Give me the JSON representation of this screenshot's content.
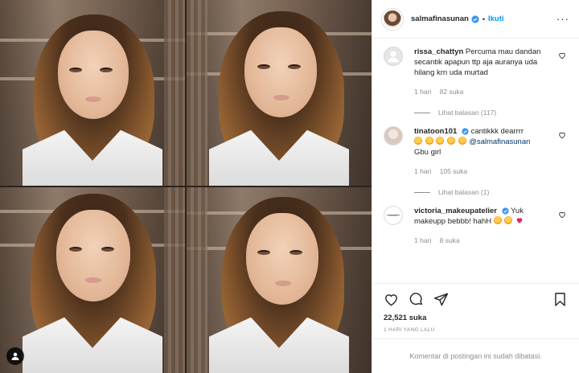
{
  "post": {
    "username": "salmafinasunan",
    "separator": "•",
    "follow_label": "Ikuti",
    "more_label": "···"
  },
  "comments": [
    {
      "username": "rissa_chattyn",
      "text": "Percuma mau dandan secantik apapun ttp aja auranya uda hilang krn uda murtad",
      "time": "1 hari",
      "likes": "82 suka",
      "replies_label": "Lihat balasan (117)"
    },
    {
      "username": "tinatoon101",
      "text": "cantikkk dearrrr",
      "mention": "@salmafinasunan",
      "text_after": "Gbu girl",
      "time": "1 hari",
      "likes": "105 suka",
      "replies_label": "Lihat balasan (1)"
    },
    {
      "username": "victoria_makeupatelier",
      "text": "Yuk makeupp bebbb! hahH",
      "time": "1 hari",
      "likes": "8 suka"
    }
  ],
  "likes_count": "22,521 suka",
  "post_date": "1 HARI YANG LALU",
  "comments_closed": "Komentar di postingan ini sudah dibatasi.",
  "icons": {
    "like": "heart-icon",
    "comment": "comment-icon",
    "share": "share-icon",
    "save": "bookmark-icon",
    "verified": "verified-badge-icon",
    "tag": "user-tag-icon"
  },
  "colors": {
    "accent": "#0095f6",
    "verified": "#3897f0",
    "muted": "#8e8e8e",
    "text": "#262626"
  }
}
